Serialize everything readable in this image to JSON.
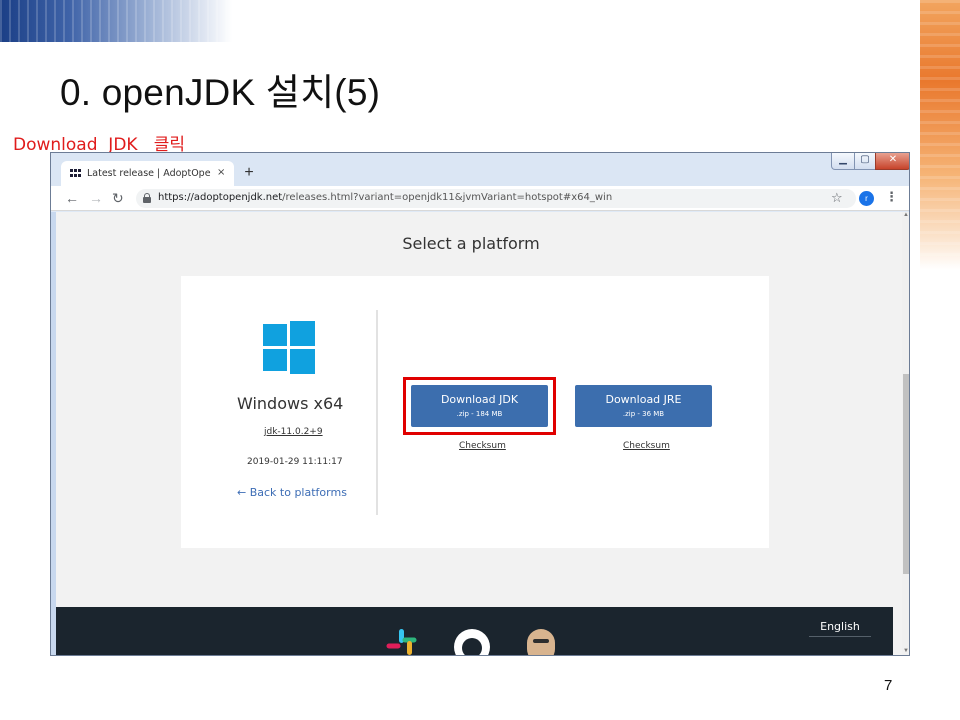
{
  "slide": {
    "title": "0. openJDK 설치(5)",
    "annotation": "Download  JDK   클릭",
    "page_number": "7"
  },
  "browser": {
    "tab_title": "Latest release | AdoptOpenJDK",
    "tab_close": "×",
    "new_tab": "+",
    "url_host": "https://adoptopenjdk.net",
    "url_rest": "/releases.html?variant=openjdk11&jvmVariant=hotspot#x64_win",
    "profile_initial": "r",
    "icons": {
      "back": "arrow-left-icon",
      "forward": "arrow-right-icon",
      "reload": "reload-icon",
      "lock": "lock-icon",
      "bookmark": "star-icon",
      "menu": "kebab-menu-icon"
    }
  },
  "page": {
    "section_title": "Select a platform",
    "platform": {
      "name": "Windows x64",
      "version": "jdk-11.0.2+9",
      "release_date": "2019-01-29 11:11:17",
      "back_link": "← Back to platforms"
    },
    "downloads": [
      {
        "label": "Download JDK",
        "size": ".zip - 184 MB",
        "checksum": "Checksum"
      },
      {
        "label": "Download JRE",
        "size": ".zip - 36 MB",
        "checksum": "Checksum"
      }
    ],
    "footer": {
      "language": "English"
    }
  },
  "colors": {
    "annotation": "#e01c1c",
    "highlight_border": "#e00000",
    "button": "#3c6eae",
    "windows_logo": "#10a1df",
    "footer": "#1b252e"
  }
}
